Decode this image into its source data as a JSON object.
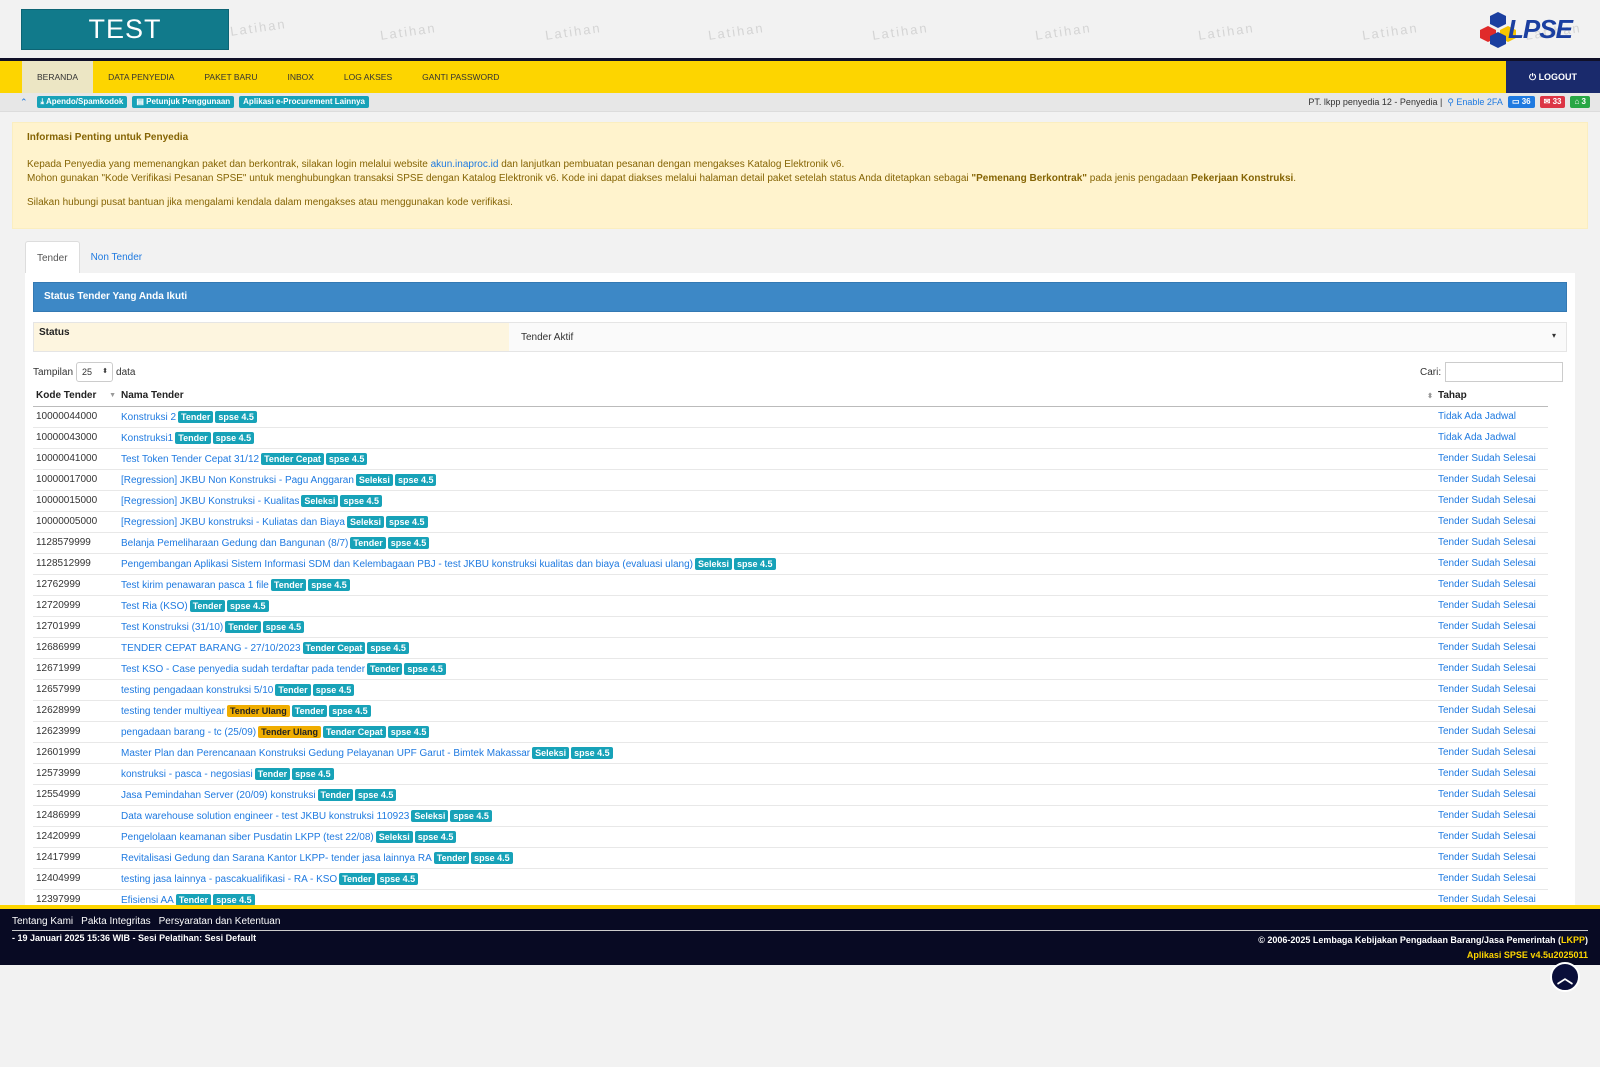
{
  "header": {
    "test_label": "TEST",
    "watermark": "Latihan",
    "logo_text": "LPSE"
  },
  "nav": {
    "items": [
      "BERANDA",
      "DATA PENYEDIA",
      "PAKET BARU",
      "INBOX",
      "LOG AKSES",
      "GANTI PASSWORD"
    ],
    "logout": "LOGOUT"
  },
  "subbar": {
    "links": [
      "Apendo/Spamkodok",
      "Petunjuk Penggunaan",
      "Aplikasi e-Procurement Lainnya"
    ],
    "user": "PT. lkpp penyedia 12 - Penyedia |",
    "enable_2fa": "Enable 2FA",
    "counter_blue": "36",
    "counter_red": "33",
    "counter_green": "3"
  },
  "alert": {
    "title": "Informasi Penting untuk Penyedia",
    "line1_pre": "Kepada Penyedia yang memenangkan paket dan berkontrak, silakan login melalui website ",
    "line1_link": "akun.inaproc.id",
    "line1_post": " dan lanjutkan pembuatan pesanan dengan mengakses Katalog Elektronik v6.",
    "line2_pre": "Mohon gunakan \"Kode Verifikasi Pesanan SPSE\" untuk menghubungkan transaksi SPSE dengan Katalog Elektronik v6. Kode ini dapat diakses melalui halaman detail paket setelah status Anda ditetapkan sebagai ",
    "line2_bold": "\"Pemenang Berkontrak\"",
    "line2_mid": " pada jenis pengadaan ",
    "line2_bold2": "Pekerjaan Konstruksi",
    "line2_post": ".",
    "line3": "Silakan hubungi pusat bantuan jika mengalami kendala dalam mengakses atau menggunakan kode verifikasi."
  },
  "tabs": [
    "Tender",
    "Non Tender"
  ],
  "panel": {
    "title": "Status Tender Yang Anda Ikuti",
    "filter_label": "Status",
    "filter_value": "Tender Aktif",
    "len_pre": "Tampilan",
    "len_value": "25",
    "len_post": "data",
    "search_label": "Cari:"
  },
  "table": {
    "headers": [
      "Kode Tender",
      "Nama Tender",
      "Tahap"
    ],
    "rows": [
      {
        "kode": "10000044000",
        "nama": "Konstruksi 2",
        "badges": [
          "Tender",
          "spse 4.5"
        ],
        "tahap": "Tidak Ada Jadwal"
      },
      {
        "kode": "10000043000",
        "nama": "Konstruksi1",
        "badges": [
          "Tender",
          "spse 4.5"
        ],
        "tahap": "Tidak Ada Jadwal"
      },
      {
        "kode": "10000041000",
        "nama": "Test Token Tender Cepat 31/12",
        "badges": [
          "Tender Cepat",
          "spse 4.5"
        ],
        "tahap": "Tender Sudah Selesai"
      },
      {
        "kode": "10000017000",
        "nama": "[Regression] JKBU Non Konstruksi - Pagu Anggaran",
        "badges": [
          "Seleksi",
          "spse 4.5"
        ],
        "tahap": "Tender Sudah Selesai"
      },
      {
        "kode": "10000015000",
        "nama": "[Regression] JKBU Konstruksi - Kualitas",
        "badges": [
          "Seleksi",
          "spse 4.5"
        ],
        "tahap": "Tender Sudah Selesai"
      },
      {
        "kode": "10000005000",
        "nama": "[Regression] JKBU konstruksi - Kuliatas dan Biaya",
        "badges": [
          "Seleksi",
          "spse 4.5"
        ],
        "tahap": "Tender Sudah Selesai"
      },
      {
        "kode": "1128579999",
        "nama": "Belanja Pemeliharaan Gedung dan Bangunan (8/7)",
        "badges": [
          "Tender",
          "spse 4.5"
        ],
        "tahap": "Tender Sudah Selesai"
      },
      {
        "kode": "1128512999",
        "nama": "Pengembangan Aplikasi Sistem Informasi SDM dan Kelembagaan PBJ - test JKBU konstruksi kualitas dan biaya (evaluasi ulang)",
        "badges": [
          "Seleksi",
          "spse 4.5"
        ],
        "tahap": "Tender Sudah Selesai"
      },
      {
        "kode": "12762999",
        "nama": "Test kirim penawaran pasca 1 file",
        "badges": [
          "Tender",
          "spse 4.5"
        ],
        "tahap": "Tender Sudah Selesai"
      },
      {
        "kode": "12720999",
        "nama": "Test Ria (KSO)",
        "badges": [
          "Tender",
          "spse 4.5"
        ],
        "tahap": "Tender Sudah Selesai"
      },
      {
        "kode": "12701999",
        "nama": "Test Konstruksi (31/10)",
        "badges": [
          "Tender",
          "spse 4.5"
        ],
        "tahap": "Tender Sudah Selesai"
      },
      {
        "kode": "12686999",
        "nama": "TENDER CEPAT BARANG - 27/10/2023",
        "badges": [
          "Tender Cepat",
          "spse 4.5"
        ],
        "tahap": "Tender Sudah Selesai"
      },
      {
        "kode": "12671999",
        "nama": "Test KSO - Case penyedia sudah terdaftar pada tender",
        "badges": [
          "Tender",
          "spse 4.5"
        ],
        "tahap": "Tender Sudah Selesai"
      },
      {
        "kode": "12657999",
        "nama": "testing pengadaan konstruksi 5/10",
        "badges": [
          "Tender",
          "spse 4.5"
        ],
        "tahap": "Tender Sudah Selesai"
      },
      {
        "kode": "12628999",
        "nama": "testing tender multiyear",
        "badges": [
          "Tender Ulang",
          "Tender",
          "spse 4.5"
        ],
        "tahap": "Tender Sudah Selesai"
      },
      {
        "kode": "12623999",
        "nama": "pengadaan barang - tc (25/09)",
        "badges": [
          "Tender Ulang",
          "Tender Cepat",
          "spse 4.5"
        ],
        "tahap": "Tender Sudah Selesai"
      },
      {
        "kode": "12601999",
        "nama": "Master Plan dan Perencanaan Konstruksi Gedung Pelayanan UPF Garut - Bimtek Makassar",
        "badges": [
          "Seleksi",
          "spse 4.5"
        ],
        "tahap": "Tender Sudah Selesai"
      },
      {
        "kode": "12573999",
        "nama": "konstruksi - pasca - negosiasi",
        "badges": [
          "Tender",
          "spse 4.5"
        ],
        "tahap": "Tender Sudah Selesai"
      },
      {
        "kode": "12554999",
        "nama": "Jasa Pemindahan Server (20/09) konstruksi",
        "badges": [
          "Tender",
          "spse 4.5"
        ],
        "tahap": "Tender Sudah Selesai"
      },
      {
        "kode": "12486999",
        "nama": "Data warehouse solution engineer - test JKBU konstruksi 110923",
        "badges": [
          "Seleksi",
          "spse 4.5"
        ],
        "tahap": "Tender Sudah Selesai"
      },
      {
        "kode": "12420999",
        "nama": "Pengelolaan keamanan siber Pusdatin LKPP (test 22/08)",
        "badges": [
          "Seleksi",
          "spse 4.5"
        ],
        "tahap": "Tender Sudah Selesai"
      },
      {
        "kode": "12417999",
        "nama": "Revitalisasi Gedung dan Sarana Kantor LKPP- tender jasa lainnya RA",
        "badges": [
          "Tender",
          "spse 4.5"
        ],
        "tahap": "Tender Sudah Selesai"
      },
      {
        "kode": "12404999",
        "nama": "testing jasa lainnya - pascakualifikasi - RA - KSO",
        "badges": [
          "Tender",
          "spse 4.5"
        ],
        "tahap": "Tender Sudah Selesai"
      },
      {
        "kode": "12397999",
        "nama": "Efisiensi AA",
        "badges": [
          "Tender",
          "spse 4.5"
        ],
        "tahap": "Tender Sudah Selesai"
      }
    ]
  },
  "footer": {
    "links": [
      "Tentang Kami",
      "Pakta Integritas",
      "Persyaratan dan Ketentuan"
    ],
    "date": "- 19 Januari 2025 15:36 WIB - Sesi Pelatihan: Sesi Default",
    "copy_pre": "© 2006-2025 Lembaga Kebijakan Pengadaan Barang/Jasa Pemerintah (",
    "copy_lkpp": "LKPP",
    "copy_post": ")",
    "app": "Aplikasi SPSE v4.5u2025011"
  },
  "colors": {
    "accent_yellow": "#fdd500",
    "navy": "#080a23",
    "teal": "#117a8b",
    "link_blue": "#1f7ae0"
  }
}
